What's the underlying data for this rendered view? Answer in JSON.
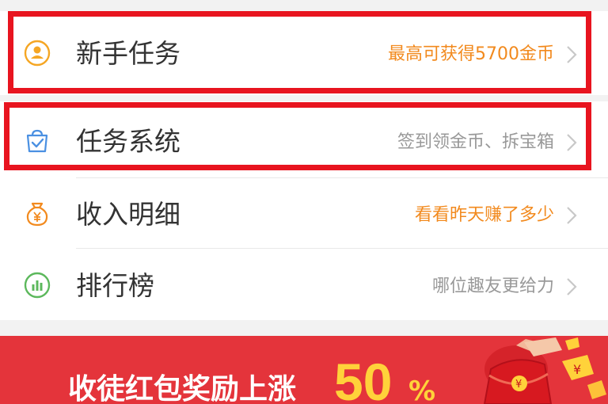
{
  "menu": {
    "items": [
      {
        "label": "新手任务",
        "subtitle": "最高可获得5700金币",
        "icon": "user-badge-icon",
        "subtitle_color": "#f28a1e"
      },
      {
        "label": "任务系统",
        "subtitle": "签到领金币、拆宝箱",
        "icon": "task-bag-icon",
        "subtitle_color": "#999999"
      },
      {
        "label": "收入明细",
        "subtitle": "看看昨天赚了多少",
        "icon": "yuan-bag-icon",
        "subtitle_color": "#f28a1e"
      },
      {
        "label": "排行榜",
        "subtitle": "哪位趣友更给力",
        "icon": "bar-chart-icon",
        "subtitle_color": "#999999"
      }
    ]
  },
  "banner": {
    "text": "收徒红包奖励上涨",
    "number": "50",
    "percent": "%",
    "background": "#e4343b",
    "accent": "#ffd23a"
  },
  "colors": {
    "highlight": "#e8141f",
    "orange": "#f28a1e",
    "gray_text": "#999999",
    "label_text": "#333333"
  }
}
